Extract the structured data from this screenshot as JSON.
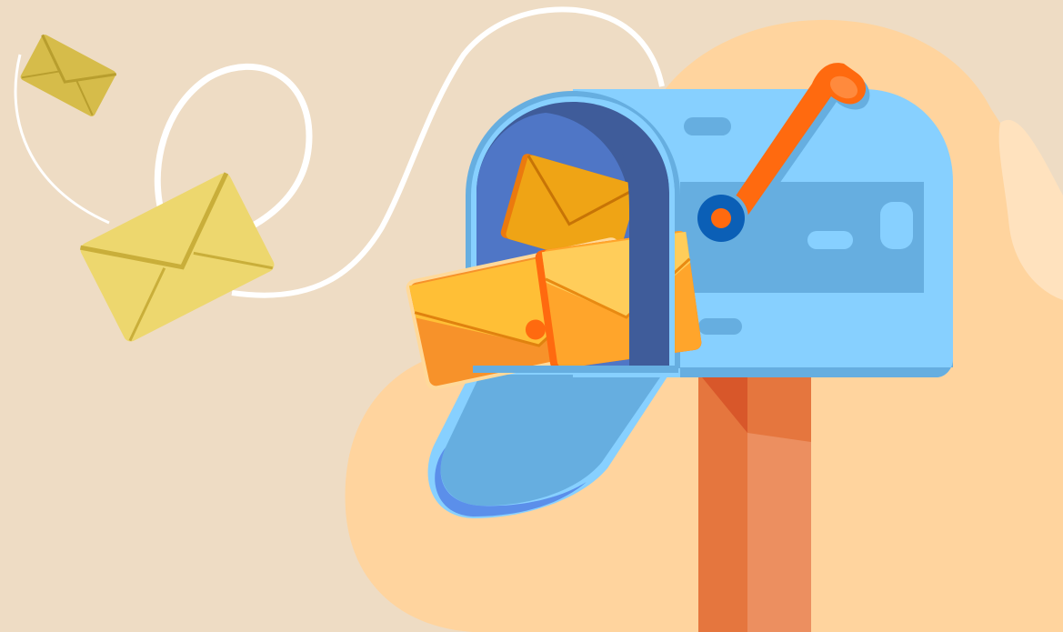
{
  "scene": {
    "subject": "mailbox-with-flying-envelopes",
    "palette": {
      "background": "#EEDCC4",
      "blob": "#FFD49E",
      "mailbox_body": "#87D0FF",
      "mailbox_shade": "#66AEE0",
      "mailbox_inner": "#3F5C9A",
      "mailbox_inner_light": "#4F76C6",
      "flag": "#FF6A0F",
      "flag_pivot": "#0B5FB6",
      "post_dark": "#E5763E",
      "post_light": "#EC8F60",
      "post_top_shade": "#D8572A",
      "envelope_yellow": "#EDD76E",
      "envelope_yellow_dark": "#D6BC4A",
      "envelope_orange": "#F7922A",
      "envelope_orange_light": "#FFBF36",
      "envelope_amber": "#EFA415",
      "envelope_deep": "#EB7A0E",
      "trail": "#FFFFFF"
    },
    "icons": [
      "envelope-icon",
      "mailbox-icon",
      "flag-icon"
    ]
  }
}
